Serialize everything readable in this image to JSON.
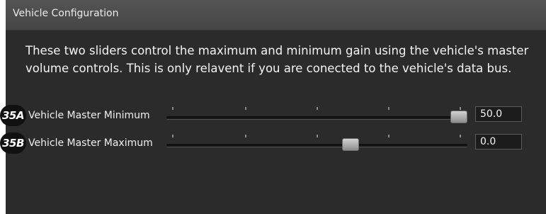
{
  "window": {
    "title": "Vehicle Configuration"
  },
  "description": "These two sliders control the maximum and minimum gain using the vehicle's master volume controls. This is only relavent if you are conected to the vehicle's data bus.",
  "sliders": [
    {
      "badge": "35A",
      "label": "Vehicle Master Minimum",
      "value": "50.0",
      "position_fraction": 0.97
    },
    {
      "badge": "35B",
      "label": "Vehicle Master Maximum",
      "value": "0.0",
      "position_fraction": 0.61
    }
  ],
  "colors": {
    "panel_background": "#2b2b2b",
    "header_background": "#4e4e4e",
    "text": "#f0f0f0",
    "badge_background": "#111111"
  }
}
